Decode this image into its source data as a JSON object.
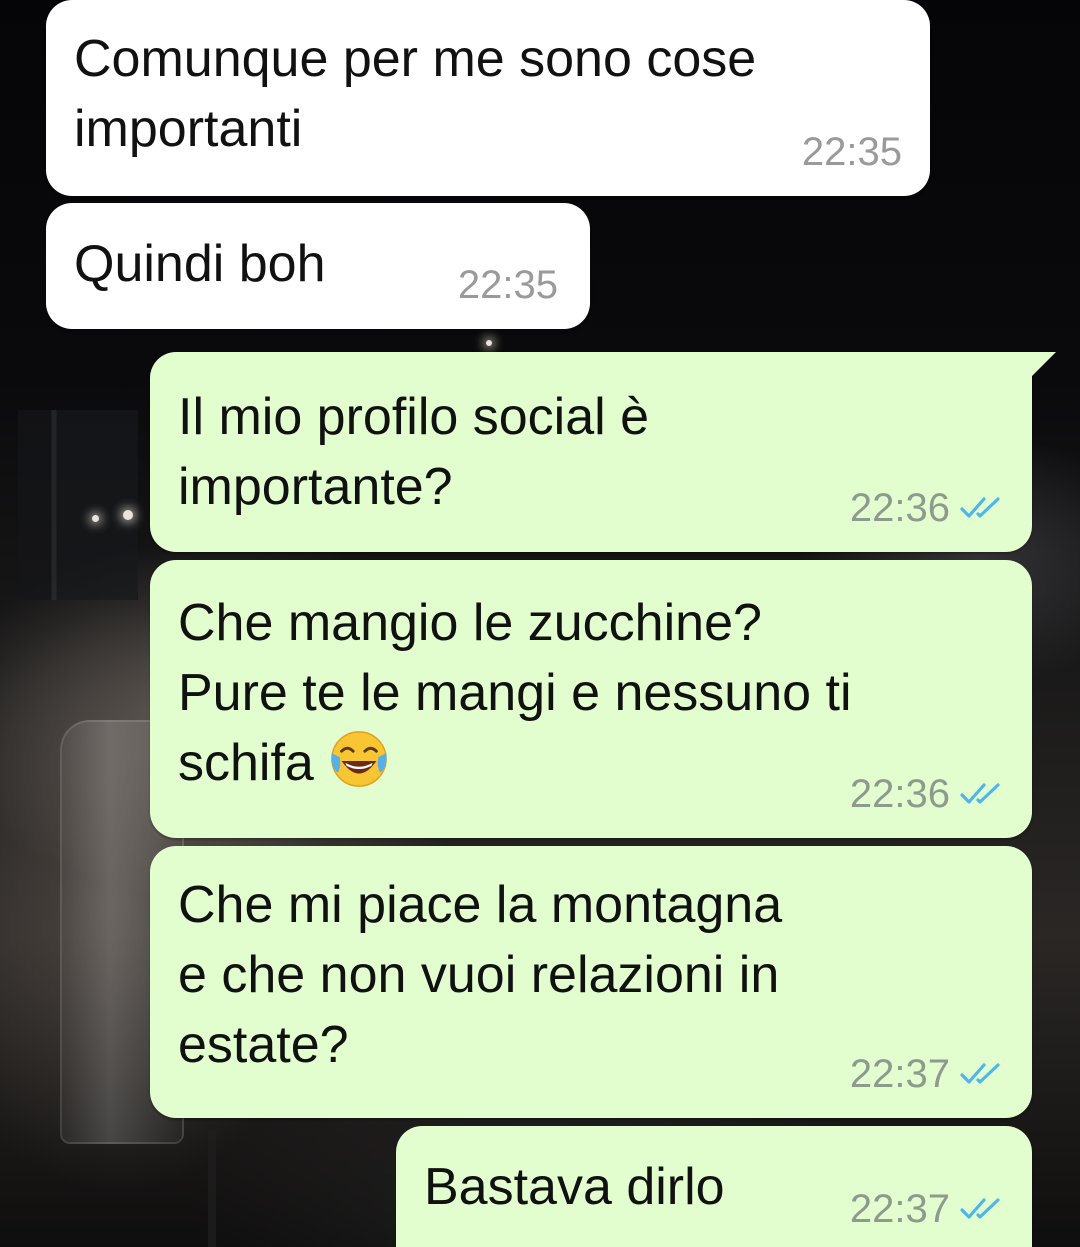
{
  "conversation": {
    "messages": [
      {
        "direction": "incoming",
        "lines": [
          "Comunque per me sono cose",
          "importanti"
        ],
        "time": "22:35"
      },
      {
        "direction": "incoming",
        "lines": [
          "Quindi boh"
        ],
        "time": "22:35"
      },
      {
        "direction": "outgoing",
        "lines": [
          "Il mio profilo social è",
          "importante?"
        ],
        "time": "22:36",
        "status": "read"
      },
      {
        "direction": "outgoing",
        "lines": [
          "Che mangio le zucchine?",
          "Pure te le mangi e nessuno ti",
          "schifa"
        ],
        "emoji": "face-with-tears-of-joy",
        "time": "22:36",
        "status": "read"
      },
      {
        "direction": "outgoing",
        "lines": [
          "Che mi piace la montagna",
          "e che non vuoi relazioni in",
          "estate?"
        ],
        "time": "22:37",
        "status": "read"
      },
      {
        "direction": "outgoing",
        "lines": [
          "Bastava dirlo"
        ],
        "time": "22:37",
        "status": "read"
      }
    ]
  },
  "colors": {
    "incoming_bubble": "#ffffff",
    "outgoing_bubble": "#e2fecf",
    "read_ticks": "#4fb6ec",
    "timestamp": "#8e9a8e"
  }
}
